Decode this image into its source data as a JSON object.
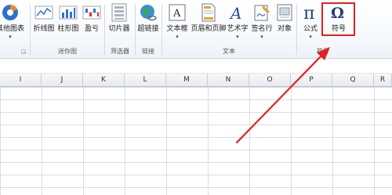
{
  "ribbon": {
    "buttons": {
      "other_charts": "其他图表",
      "sparkline_line": "折线图",
      "sparkline_column": "柱形图",
      "sparkline_winloss": "盈亏",
      "slicer": "切片器",
      "hyperlink": "超链接",
      "textbox": "文本框",
      "header_footer": "页眉和页脚",
      "wordart": "艺术字",
      "signature_line": "签名行",
      "object": "对象",
      "equation": "公式",
      "symbol": "符号"
    },
    "groups": {
      "sparklines": "迷你图",
      "filter": "筛选器",
      "links": "链接",
      "text": "文本",
      "symbols": "符号"
    }
  },
  "sheet": {
    "columns": [
      "I",
      "J",
      "K",
      "L",
      "M",
      "N",
      "O",
      "P",
      "Q",
      "R"
    ]
  },
  "colors": {
    "annotation": "#e02222",
    "ribbon_bg": "#f7f9fc",
    "grid_line": "#dadcdf"
  }
}
